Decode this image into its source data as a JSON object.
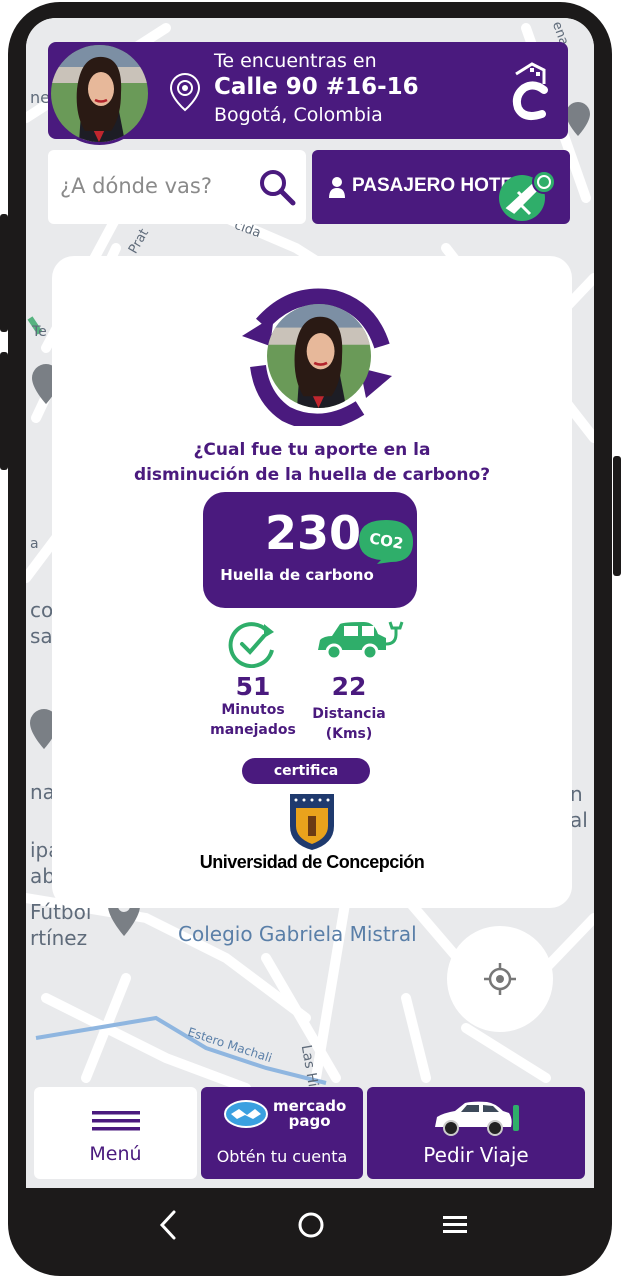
{
  "header": {
    "location_prefix": "Te encuentras en",
    "street": "Calle 90 #16-16",
    "city": "Bogotá, Colombia",
    "icons": [
      "avatar",
      "location-pin-icon",
      "app-logo-icon"
    ]
  },
  "search": {
    "placeholder": "¿A dónde vas?",
    "icon": "search-icon"
  },
  "pasajero_button": {
    "label": "PASAJERO HOTELES",
    "icons": [
      "person-icon",
      "plane-icon",
      "whatsapp-icon"
    ]
  },
  "carbon_card": {
    "question_line1": "¿Cual fue tu aporte en la",
    "question_line2": "disminución de la huella de carbono?",
    "co2_value": "230",
    "co2_unit_badge": "CO2",
    "co2_caption": "Huella de carbono",
    "stats": [
      {
        "value": "51",
        "label_line1": "Minutos",
        "label_line2": "manejados",
        "icon": "clock-check-icon"
      },
      {
        "value": "22",
        "label_line1": "Distancia",
        "label_line2": "(Kms)",
        "icon": "electric-car-icon"
      }
    ],
    "certifica_label": "certifica",
    "university": "Universidad de Concepción"
  },
  "map": {
    "labels": [
      "Colegio Gabriela Mistral",
      "Estero Machali",
      "Las Hi",
      "Fútbol",
      "rtínez",
      "Prat",
      "cida",
      "co",
      "sal",
      "nal",
      "ipa",
      "ab",
      "al",
      "n",
      "ne",
      "ena",
      "Te",
      "a"
    ]
  },
  "bottom_bar": {
    "menu_label": "Menú",
    "mercado_pago_line1": "mercado",
    "mercado_pago_line2": "pago",
    "mercado_pago_label": "Obtén tu cuenta",
    "pedir_label": "Pedir Viaje"
  },
  "colors": {
    "brand_purple": "#4a1a7e",
    "eco_green": "#2fae6a",
    "map_bg": "#e9eaec"
  },
  "system_nav": [
    "back-icon",
    "home-icon",
    "recents-icon"
  ]
}
